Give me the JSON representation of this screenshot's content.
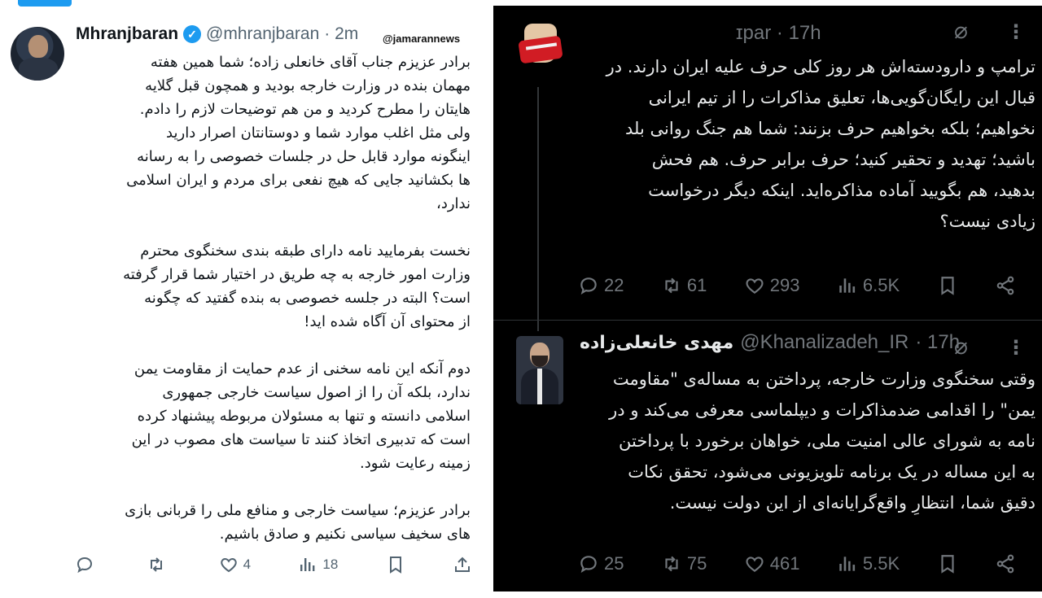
{
  "left_tweet": {
    "author_name": "Mhranjbaran",
    "handle": "@mhranjbaran",
    "time": "· 2m",
    "watermark": "@jamarannews",
    "verified_mark": "✓",
    "paragraphs": [
      [
        "برادر عزیزم جناب آقای خانعلی زاده؛ شما همین هفته",
        "مهمان بنده در وزارت خارجه بودید و همچون قبل گلایه",
        "هایتان را مطرح کردید و من هم توضیحات لازم را دادم.",
        "ولی مثل اغلب موارد شما و دوستانتان اصرار دارید",
        "اینگونه موارد قابل حل در جلسات خصوصی را به رسانه",
        "ها بکشانید جایی که هیچ نفعی برای مردم و ایران اسلامی",
        "ندارد،"
      ],
      [
        "نخست بفرمایید نامه دارای طبقه بندی سخنگوی محترم",
        "وزارت امور خارجه به چه طریق در اختیار شما قرار گرفته",
        "است؟ البته در جلسه خصوصی به بنده گفتید که چگونه",
        "از محتوای آن آگاه شده اید!"
      ],
      [
        "دوم آنکه این نامه سخنی از عدم حمایت از مقاومت یمن",
        "ندارد، بلکه آن را از اصول سیاست خارجی جمهوری",
        "اسلامی دانسته و تنها به مسئولان مربوطه پیشنهاد کرده",
        "است که تدبیری اتخاذ کنند تا سیاست های مصوب در این",
        "زمینه رعایت شود."
      ],
      [
        "برادر عزیزم؛ سیاست خارجی و منافع ملی را قربانی بازی",
        "های سخیف سیاسی نکنیم و صادق باشیم."
      ]
    ],
    "actions": {
      "replies": "",
      "retweets": "",
      "likes": "4",
      "views": "18"
    }
  },
  "right_top_tweet": {
    "author_partial": "ɪpar",
    "time": "· 17h",
    "grok_icon": "⌀",
    "more_icon": "⋮",
    "lines": [
      "ترامپ و دارودسته‌اش هر روز کلی حرف علیه ایران دارند. در",
      "قبال این رایگان‌گویی‌ها، تعلیق مذاکرات را از تیم ایرانی",
      "نخواهیم؛ بلکه بخواهیم حرف بزنند: شما هم جنگ روانی بلد",
      "باشید؛ تهدید و تحقیر کنید؛ حرف برابر حرف. هم فحش",
      "بدهید، هم بگویید آماده مذاکره‌اید. اینکه دیگر درخواست",
      "زیادی نیست؟"
    ],
    "actions": {
      "replies": "22",
      "retweets": "61",
      "likes": "293",
      "views": "6.5K"
    }
  },
  "right_bottom_tweet": {
    "author_name": "مهدی خانعلی‌زاده",
    "handle": "@Khanalizadeh_IR",
    "time": "· 17h",
    "grok_icon": "⌀",
    "more_icon": "⋮",
    "lines": [
      "وقتی سخنگوی وزارت خارجه، پرداختن به مساله‌ی \"مقاومت",
      "یمن\" را اقدامی ضدمذاکرات و دیپلماسی معرفی می‌کند و در",
      "نامه به شورای عالی امنیت ملی، خواهان برخورد با پرداختن",
      "به این مساله در یک برنامه تلویزیونی می‌شود، تحقق نکات",
      "دقیق شما، انتظارِ واقع‌گرایانه‌ای از این دولت نیست."
    ],
    "actions": {
      "replies": "25",
      "retweets": "75",
      "likes": "461",
      "views": "5.5K"
    }
  },
  "colors": {
    "accent": "#1d9bf0",
    "dark_bg": "#000000",
    "muted": "#71767b",
    "light_muted": "#536471"
  }
}
